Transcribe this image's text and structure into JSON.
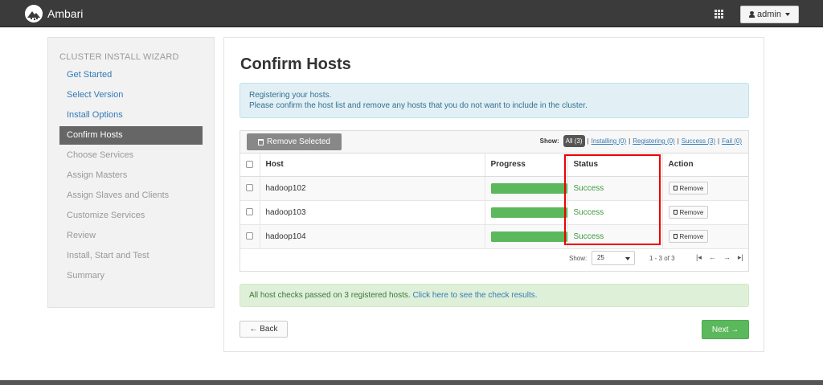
{
  "header": {
    "brand": "Ambari",
    "user_label": "admin",
    "icons": [
      "ambari-logo-icon",
      "grid-icon",
      "user-icon",
      "chevron-down-icon"
    ]
  },
  "wizard": {
    "title": "CLUSTER INSTALL WIZARD",
    "steps": [
      {
        "label": "Get Started",
        "state": "done"
      },
      {
        "label": "Select Version",
        "state": "done"
      },
      {
        "label": "Install Options",
        "state": "done"
      },
      {
        "label": "Confirm Hosts",
        "state": "active"
      },
      {
        "label": "Choose Services",
        "state": "todo"
      },
      {
        "label": "Assign Masters",
        "state": "todo"
      },
      {
        "label": "Assign Slaves and Clients",
        "state": "todo"
      },
      {
        "label": "Customize Services",
        "state": "todo"
      },
      {
        "label": "Review",
        "state": "todo"
      },
      {
        "label": "Install, Start and Test",
        "state": "todo"
      },
      {
        "label": "Summary",
        "state": "todo"
      }
    ]
  },
  "main": {
    "title": "Confirm Hosts",
    "info_line1": "Registering your hosts.",
    "info_line2": "Please confirm the host list and remove any hosts that you do not want to include in the cluster.",
    "remove_selected_label": "Remove Selected",
    "filters": {
      "show_label": "Show:",
      "all": "All (3)",
      "installing": "Installing (0)",
      "registering": "Registering (0)",
      "success": "Success (3)",
      "fail": "Fail (0)"
    },
    "table": {
      "headers": {
        "host": "Host",
        "progress": "Progress",
        "status": "Status",
        "action": "Action"
      },
      "rows": [
        {
          "host": "hadoop102",
          "progress": 1.0,
          "status": "Success",
          "action": "Remove"
        },
        {
          "host": "hadoop103",
          "progress": 1.0,
          "status": "Success",
          "action": "Remove"
        },
        {
          "host": "hadoop104",
          "progress": 1.0,
          "status": "Success",
          "action": "Remove"
        }
      ]
    },
    "footer": {
      "show_label": "Show:",
      "page_size": "25",
      "range": "1 - 3 of 3"
    },
    "check_message": "All host checks passed on 3 registered hosts.",
    "check_link": "Click here to see the check results.",
    "back_label": "← Back",
    "next_label": "Next →"
  },
  "colors": {
    "topbar": "#3b3b3b",
    "link": "#337ab7",
    "success": "#5cb85c",
    "active_step": "#666666",
    "highlight": "#ee0000"
  }
}
